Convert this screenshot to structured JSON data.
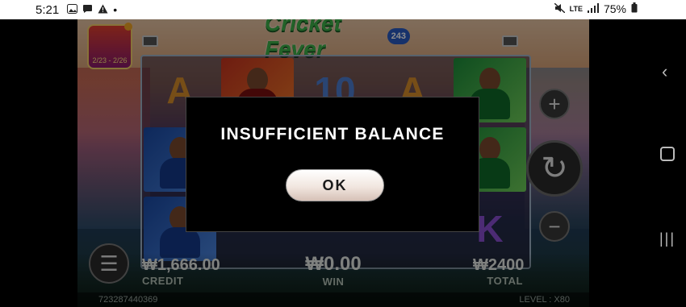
{
  "status_bar": {
    "time": "5:21",
    "notification_icons": [
      "image-icon",
      "chat-bubble-icon",
      "warning-icon",
      "dot-icon"
    ],
    "network_label": "LTE",
    "battery_percent": "75%"
  },
  "game": {
    "logo_text": "Cricket Fever",
    "logo_badge": "243",
    "promo_text": "2/23 - 2/26",
    "reels": [
      [
        "A",
        "player-blue",
        "player-blue"
      ],
      [
        "player-red",
        "",
        ""
      ],
      [
        "10",
        "",
        ""
      ],
      [
        "A",
        "",
        ""
      ],
      [
        "player-green",
        "player-green",
        "K"
      ]
    ],
    "credit_value": "₩1,666.00",
    "credit_label": "CREDIT",
    "win_value": "₩0.00",
    "win_label": "WIN",
    "total_value": "₩2400",
    "total_label": "TOTAL",
    "session_id": "723287440369",
    "level_label": "LEVEL",
    "level_value": "X80"
  },
  "dialog": {
    "message": "INSUFFICIENT BALANCE",
    "ok_label": "OK"
  }
}
